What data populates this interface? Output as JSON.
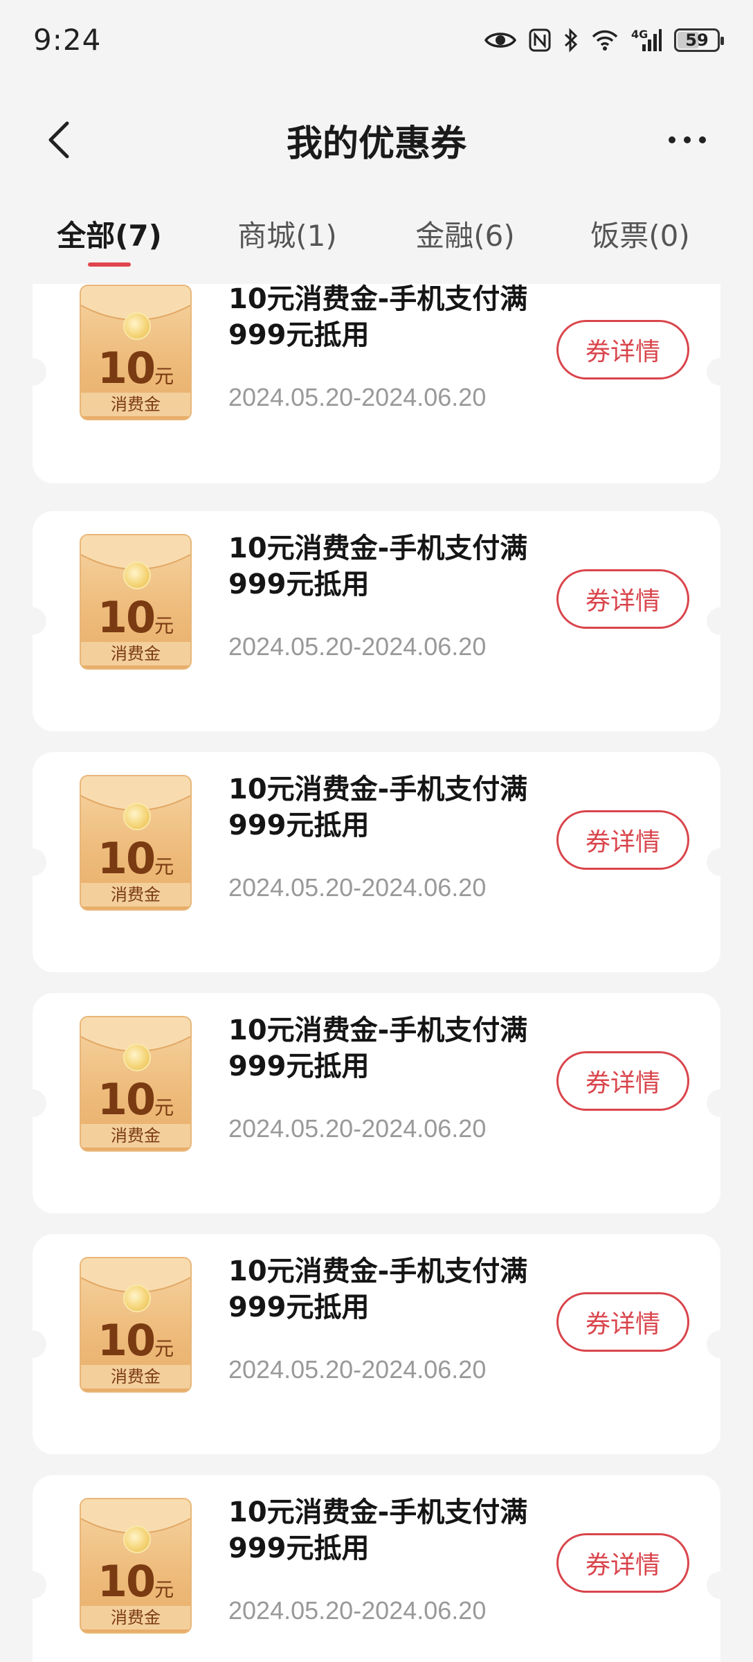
{
  "status_bar": {
    "time": "9:24",
    "network": "4G",
    "battery": "59",
    "battery_level": 59,
    "icons": [
      "eye-icon",
      "nfc-icon",
      "bluetooth-icon",
      "wifi-icon",
      "signal-icon",
      "battery-icon"
    ]
  },
  "header": {
    "title": "我的优惠券",
    "back_icon": "chevron-left-icon",
    "more_icon": "more-dots-icon"
  },
  "tabs": [
    {
      "label": "全部(7)",
      "active": true
    },
    {
      "label": "商城(1)",
      "active": false
    },
    {
      "label": "金融(6)",
      "active": false
    },
    {
      "label": "饭票(0)",
      "active": false
    }
  ],
  "coupons": [
    {
      "amount": "10",
      "unit": "元",
      "badge": "消费金",
      "title": "10元消费金-手机支付满999元抵用",
      "dates": "2024.05.20-2024.06.20",
      "button": "券详情"
    },
    {
      "amount": "10",
      "unit": "元",
      "badge": "消费金",
      "title": "10元消费金-手机支付满999元抵用",
      "dates": "2024.05.20-2024.06.20",
      "button": "券详情"
    },
    {
      "amount": "10",
      "unit": "元",
      "badge": "消费金",
      "title": "10元消费金-手机支付满999元抵用",
      "dates": "2024.05.20-2024.06.20",
      "button": "券详情"
    },
    {
      "amount": "10",
      "unit": "元",
      "badge": "消费金",
      "title": "10元消费金-手机支付满999元抵用",
      "dates": "2024.05.20-2024.06.20",
      "button": "券详情"
    },
    {
      "amount": "10",
      "unit": "元",
      "badge": "消费金",
      "title": "10元消费金-手机支付满999元抵用",
      "dates": "2024.05.20-2024.06.20",
      "button": "券详情"
    },
    {
      "amount": "10",
      "unit": "元",
      "badge": "消费金",
      "title": "10元消费金-手机支付满999元抵用",
      "dates": "2024.05.20-2024.06.20",
      "button": "券详情"
    }
  ],
  "colors": {
    "accent": "#d9454c",
    "tab_indicator": "#e0454d",
    "background": "#f4f4f4",
    "card": "#ffffff",
    "date_text": "#999999"
  }
}
